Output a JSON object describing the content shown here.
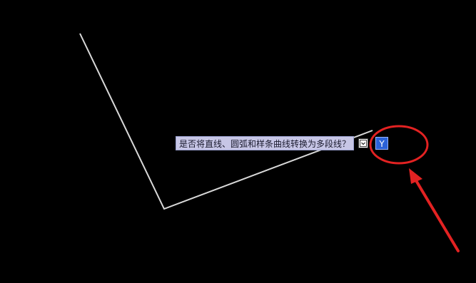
{
  "prompt": {
    "question": "是否将直线、圆弧和样条曲线转换为多段线？",
    "answer_value": "Y"
  },
  "icons": {
    "dropdown": "dropdown-arrow-icon",
    "annotation": "red-circle-arrow-annotation"
  },
  "colors": {
    "background": "#000000",
    "geometry_line": "#d9d9d9",
    "prompt_background": "#c7c6e6",
    "answer_highlight": "#2b62d8",
    "annotation": "#e32222"
  }
}
